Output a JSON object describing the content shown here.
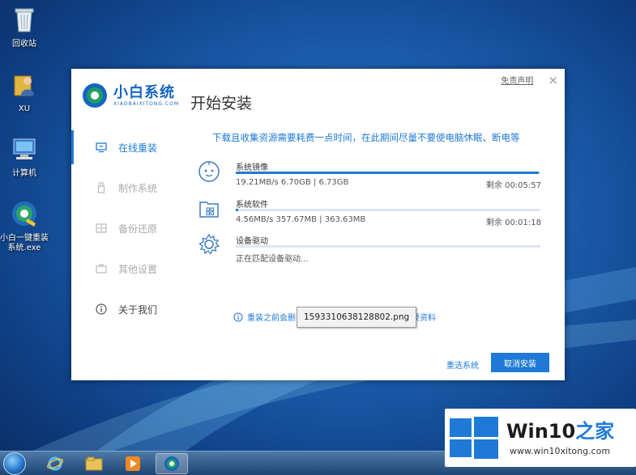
{
  "desktop": {
    "icons": [
      {
        "label": "回收站"
      },
      {
        "label": "XU"
      },
      {
        "label": "计算机"
      },
      {
        "label": "小白一键重装\n系统.exe"
      }
    ]
  },
  "window": {
    "disclaimer": "免责声明",
    "close": "×",
    "brand": {
      "name": "小白系统",
      "subtitle": "XIAOBAIXITONG.COM"
    },
    "title": "开始安装",
    "sidebar": [
      {
        "label": "在线重装",
        "icon": "monitor-icon",
        "active": true
      },
      {
        "label": "制作系统",
        "icon": "usb-icon"
      },
      {
        "label": "备份还原",
        "icon": "backup-icon"
      },
      {
        "label": "其他设置",
        "icon": "toolbox-icon"
      },
      {
        "label": "关于我们",
        "icon": "info-icon"
      }
    ],
    "notice": "下载且收集资源需要耗费一点时间，在此期间尽量不要使电脑休眠、断电等",
    "tasks": [
      {
        "name": "系统镜像",
        "stats": "19.21MB/s 6.70GB | 6.73GB",
        "eta": "剩余 00:05:57",
        "progress": 0.995,
        "icon": "disc-face-icon"
      },
      {
        "name": "系统软件",
        "stats": "4.56MB/s 357.67MB | 363.63MB",
        "eta": "剩余 00:01:18",
        "progress": 0.008,
        "icon": "folder-apps-icon"
      },
      {
        "name": "设备驱动",
        "stats": "正在匹配设备驱动...",
        "eta": "",
        "progress": 0,
        "icon": "gear-icon"
      }
    ],
    "tip": {
      "lead": "重装之前会删",
      "tail": "要资料"
    },
    "tooltip": "1593310638128802.png",
    "reselect": "重选系统",
    "cancel": "取消安装"
  },
  "watermark": {
    "brand": "Win10",
    "jia": "之家",
    "url": "www.win10xitong.com"
  },
  "colors": {
    "accent": "#1e7ad6",
    "wallpaper": "#1c5fae"
  }
}
